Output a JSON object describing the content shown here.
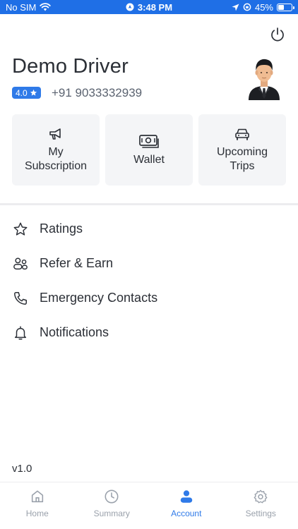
{
  "status_bar": {
    "carrier": "No SIM",
    "time": "3:48 PM",
    "battery": "45%",
    "battery_level": 0.45
  },
  "profile": {
    "name": "Demo Driver",
    "rating": "4.0",
    "phone": "+91 9033332939"
  },
  "cards": [
    {
      "label": "My\nSubscription",
      "icon": "megaphone-icon"
    },
    {
      "label": "Wallet",
      "icon": "cash-icon"
    },
    {
      "label": "Upcoming\nTrips",
      "icon": "car-icon"
    }
  ],
  "menu": [
    {
      "label": "Ratings",
      "icon": "star-icon"
    },
    {
      "label": "Refer & Earn",
      "icon": "people-icon"
    },
    {
      "label": "Emergency Contacts",
      "icon": "phone-icon"
    },
    {
      "label": "Notifications",
      "icon": "bell-icon"
    }
  ],
  "version": "v1.0",
  "tabs": [
    {
      "label": "Home",
      "icon": "home-icon"
    },
    {
      "label": "Summary",
      "icon": "clock-icon"
    },
    {
      "label": "Account",
      "icon": "user-icon"
    },
    {
      "label": "Settings",
      "icon": "gear-icon"
    }
  ],
  "active_tab": "Account",
  "colors": {
    "accent": "#2f7ae8",
    "status_bar": "#1f6fe6",
    "inactive": "#9aa1ab"
  }
}
